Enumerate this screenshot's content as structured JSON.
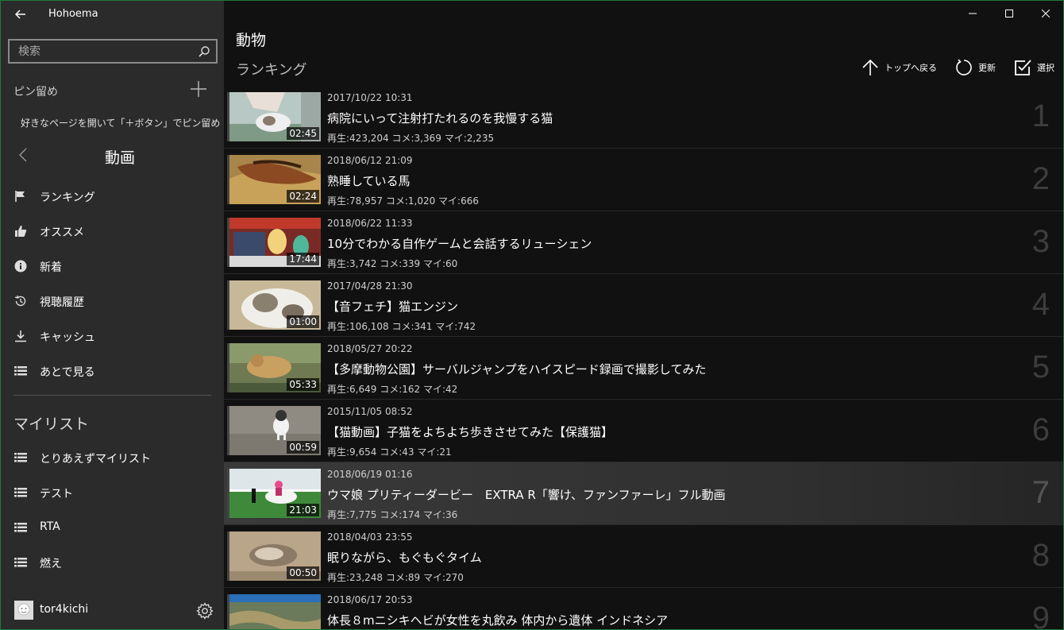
{
  "app": {
    "title": "Hohoema"
  },
  "search": {
    "placeholder": "検索"
  },
  "pin": {
    "label": "ピン留め",
    "hint": "好きなページを開いて「＋ボタン」でピン留め"
  },
  "group": {
    "title": "動画"
  },
  "nav": [
    {
      "label": "ランキング",
      "icon": "flag-icon"
    },
    {
      "label": "オススメ",
      "icon": "thumbs-up-icon"
    },
    {
      "label": "新着",
      "icon": "info-icon"
    },
    {
      "label": "視聴履歴",
      "icon": "history-icon"
    },
    {
      "label": "キャッシュ",
      "icon": "download-icon"
    },
    {
      "label": "あとで見る",
      "icon": "list-icon"
    }
  ],
  "mylist": {
    "title": "マイリスト",
    "items": [
      {
        "label": "とりあえずマイリスト"
      },
      {
        "label": "テスト"
      },
      {
        "label": "RTA"
      },
      {
        "label": "燃え"
      }
    ]
  },
  "user": {
    "name": "tor4kichi"
  },
  "page": {
    "title": "動物",
    "subtitle": "ランキング"
  },
  "actions": {
    "top": "トップへ戻る",
    "refresh": "更新",
    "select": "選択"
  },
  "colors": {
    "sidebar": "#2b2b2b",
    "main": "#111111",
    "accent_border": "#1f7a3a"
  },
  "videos": [
    {
      "rank": "1",
      "date": "2017/10/22 10:31",
      "title": "病院にいって注射打たれるのを我慢する猫",
      "stats": "再生:423,204 コメ:3,369 マイ:2,235",
      "duration": "02:45"
    },
    {
      "rank": "2",
      "date": "2018/06/12 21:09",
      "title": "熟睡している馬",
      "stats": "再生:78,957 コメ:1,020 マイ:666",
      "duration": "02:24"
    },
    {
      "rank": "3",
      "date": "2018/06/22 11:33",
      "title": "10分でわかる自作ゲームと会話するリューシェン",
      "stats": "再生:3,742 コメ:339 マイ:60",
      "duration": "17:44"
    },
    {
      "rank": "4",
      "date": "2017/04/28 21:30",
      "title": "【音フェチ】猫エンジン",
      "stats": "再生:106,108 コメ:341 マイ:742",
      "duration": "01:00"
    },
    {
      "rank": "5",
      "date": "2018/05/27 20:22",
      "title": "【多摩動物公園】サーバルジャンプをハイスピード録画で撮影してみた",
      "stats": "再生:6,649 コメ:162 マイ:42",
      "duration": "05:33"
    },
    {
      "rank": "6",
      "date": "2015/11/05 08:52",
      "title": "【猫動画】子猫をよちよち歩きさせてみた【保護猫】",
      "stats": "再生:9,654 コメ:43 マイ:21",
      "duration": "00:59"
    },
    {
      "rank": "7",
      "date": "2018/06/19 01:16",
      "title": "ウマ娘 プリティーダービー　EXTRA R「響け、ファンファーレ」フル動画",
      "stats": "再生:7,775 コメ:174 マイ:36",
      "duration": "21:03"
    },
    {
      "rank": "8",
      "date": "2018/04/03 23:55",
      "title": "眠りながら、もぐもぐタイム",
      "stats": "再生:23,248 コメ:89 マイ:270",
      "duration": "00:50"
    },
    {
      "rank": "9",
      "date": "2018/06/17 20:53",
      "title": "体長８mニシキヘビが女性を丸飲み 体内から遺体 インドネシア",
      "stats": "",
      "duration": ""
    }
  ]
}
